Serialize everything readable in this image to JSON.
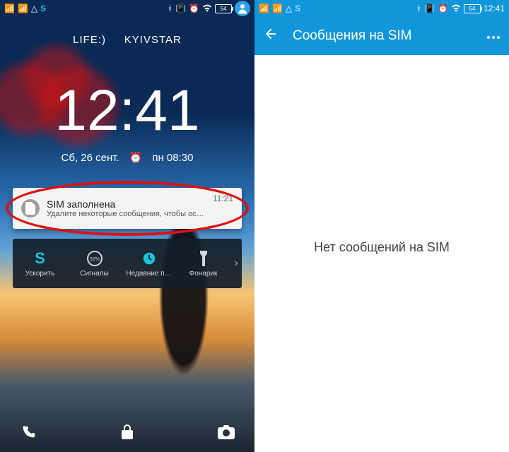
{
  "status": {
    "battery": "54",
    "time_right": "12:41",
    "icons_left": [
      "signal-bars",
      "signal-bars",
      "signal-none",
      "s-app"
    ],
    "icons_right": [
      "bluetooth",
      "vibrate",
      "alarm",
      "wifi"
    ]
  },
  "lock": {
    "carrier1": "LIFE:)",
    "carrier2": "KYIVSTAR",
    "clock": "12:41",
    "date": "Сб, 26 сент.",
    "alarm_next": "пн 08:30",
    "notification": {
      "title": "SIM заполнена",
      "body": "Удалите некоторые сообщения, чтобы освобод…",
      "time": "11:21"
    },
    "tray": [
      {
        "label": "Ускорить",
        "icon": "s-app",
        "color": "#19c3dc"
      },
      {
        "label": "Сигналы",
        "icon": "gauge",
        "color": "#cfd6dc"
      },
      {
        "label": "Недавние п…",
        "icon": "clock",
        "color": "#19c3dc"
      },
      {
        "label": "Фонарик",
        "icon": "flashlight",
        "color": "#cfd6dc"
      }
    ],
    "tray_gauge_value": "52%"
  },
  "sim_screen": {
    "title": "Сообщения на SIM",
    "empty": "Нет сообщений на SIM"
  }
}
